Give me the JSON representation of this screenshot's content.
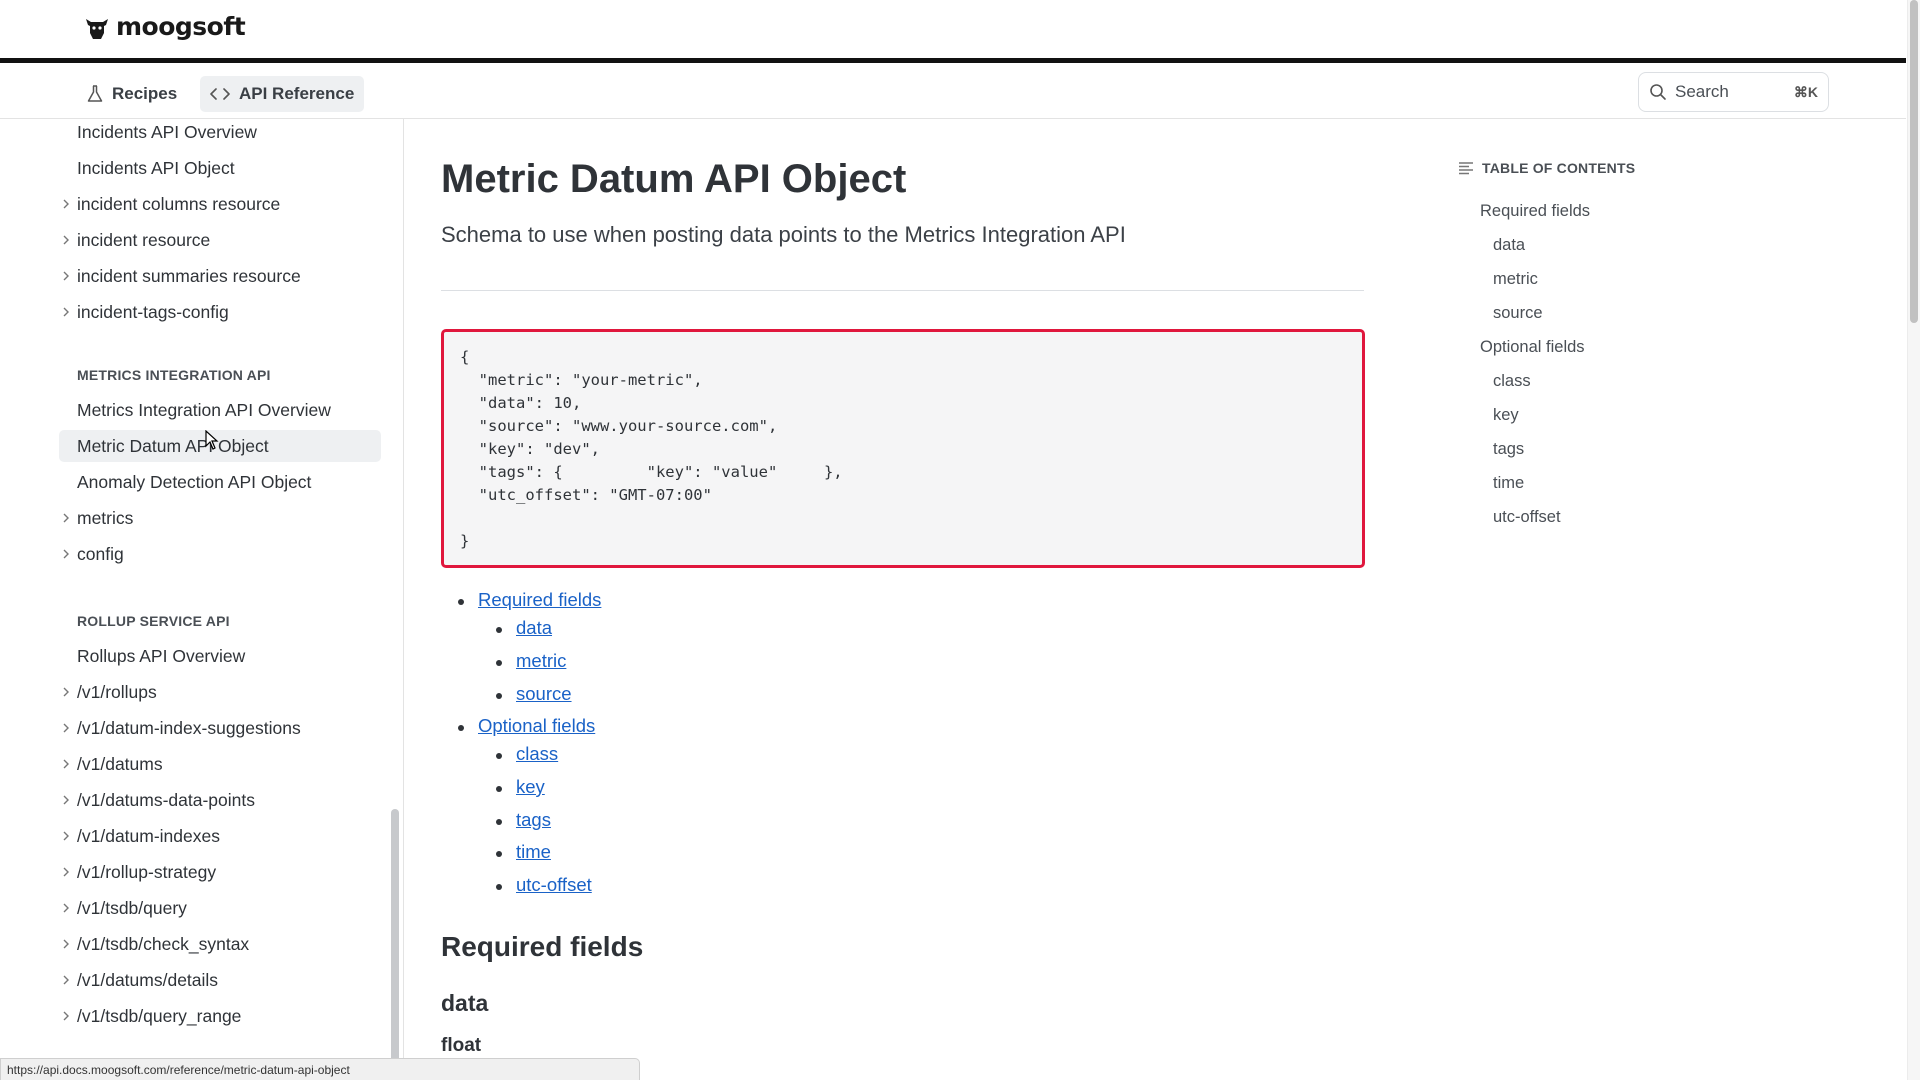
{
  "brand": {
    "name": "moogsoft"
  },
  "nav": {
    "tabs": [
      {
        "label": "Recipes"
      },
      {
        "label": "API Reference"
      }
    ],
    "search": {
      "label": "Search",
      "shortcut": "⌘K"
    }
  },
  "sidebar": {
    "items": [
      {
        "label": "Incidents API Overview"
      },
      {
        "label": "Incidents API Object"
      },
      {
        "label": "incident columns resource"
      },
      {
        "label": "incident resource"
      },
      {
        "label": "incident summaries resource"
      },
      {
        "label": "incident-tags-config"
      },
      {
        "label": "Metrics Integration API Overview"
      },
      {
        "label": "Metric Datum API Object"
      },
      {
        "label": "Anomaly Detection API Object"
      },
      {
        "label": "metrics"
      },
      {
        "label": "config"
      },
      {
        "label": "Rollups API Overview"
      },
      {
        "label": "/v1/rollups"
      },
      {
        "label": "/v1/datum-index-suggestions"
      },
      {
        "label": "/v1/datums"
      },
      {
        "label": "/v1/datums-data-points"
      },
      {
        "label": "/v1/datum-indexes"
      },
      {
        "label": "/v1/rollup-strategy"
      },
      {
        "label": "/v1/tsdb/query"
      },
      {
        "label": "/v1/tsdb/check_syntax"
      },
      {
        "label": "/v1/datums/details"
      },
      {
        "label": "/v1/tsdb/query_range"
      }
    ],
    "headings": [
      {
        "label": "METRICS INTEGRATION API"
      },
      {
        "label": "ROLLUP SERVICE API"
      }
    ]
  },
  "main": {
    "title": "Metric Datum API Object",
    "subtitle": "Schema to use when posting data points to the Metrics Integration API",
    "code": "{\n  \"metric\": \"your-metric\",\n  \"data\": 10,\n  \"source\": \"www.your-source.com\",\n  \"key\": \"dev\",\n  \"tags\": {         \"key\": \"value\"     },\n  \"utc_offset\": \"GMT-07:00\"\n\n}",
    "links": {
      "required": "Required fields",
      "required_items": [
        "data",
        "metric",
        "source"
      ],
      "optional": "Optional fields",
      "optional_items": [
        "class",
        "key",
        "tags",
        "time",
        "utc-offset"
      ]
    },
    "section_heading": "Required fields",
    "field_heading": "data",
    "field_type": "float"
  },
  "toc": {
    "heading": "TABLE OF CONTENTS",
    "items": [
      {
        "label": "Required fields"
      },
      {
        "label": "data"
      },
      {
        "label": "metric"
      },
      {
        "label": "source"
      },
      {
        "label": "Optional fields"
      },
      {
        "label": "class"
      },
      {
        "label": "key"
      },
      {
        "label": "tags"
      },
      {
        "label": "time"
      },
      {
        "label": "utc-offset"
      }
    ]
  },
  "status_url": "https://api.docs.moogsoft.com/reference/metric-datum-api-object"
}
